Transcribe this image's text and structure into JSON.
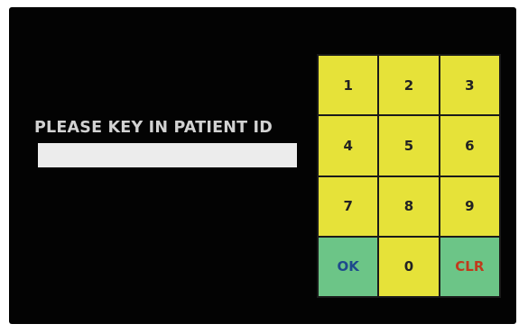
{
  "prompt": {
    "text": "PLEASE KEY IN PATIENT ID"
  },
  "patient_id_field": {
    "value": "",
    "placeholder": ""
  },
  "keypad": {
    "keys": [
      {
        "label": "1",
        "type": "digit"
      },
      {
        "label": "2",
        "type": "digit"
      },
      {
        "label": "3",
        "type": "digit"
      },
      {
        "label": "4",
        "type": "digit"
      },
      {
        "label": "5",
        "type": "digit"
      },
      {
        "label": "6",
        "type": "digit"
      },
      {
        "label": "7",
        "type": "digit"
      },
      {
        "label": "8",
        "type": "digit"
      },
      {
        "label": "9",
        "type": "digit"
      },
      {
        "label": "OK",
        "type": "confirm"
      },
      {
        "label": "0",
        "type": "digit"
      },
      {
        "label": "CLR",
        "type": "clear"
      }
    ]
  },
  "colors": {
    "screen_background": "#030303",
    "digit_key": "#e6e239",
    "action_key": "#6cc587",
    "ok_text": "#1e4a8c",
    "clr_text": "#c03a1c",
    "prompt_text": "#d2d2d2"
  }
}
